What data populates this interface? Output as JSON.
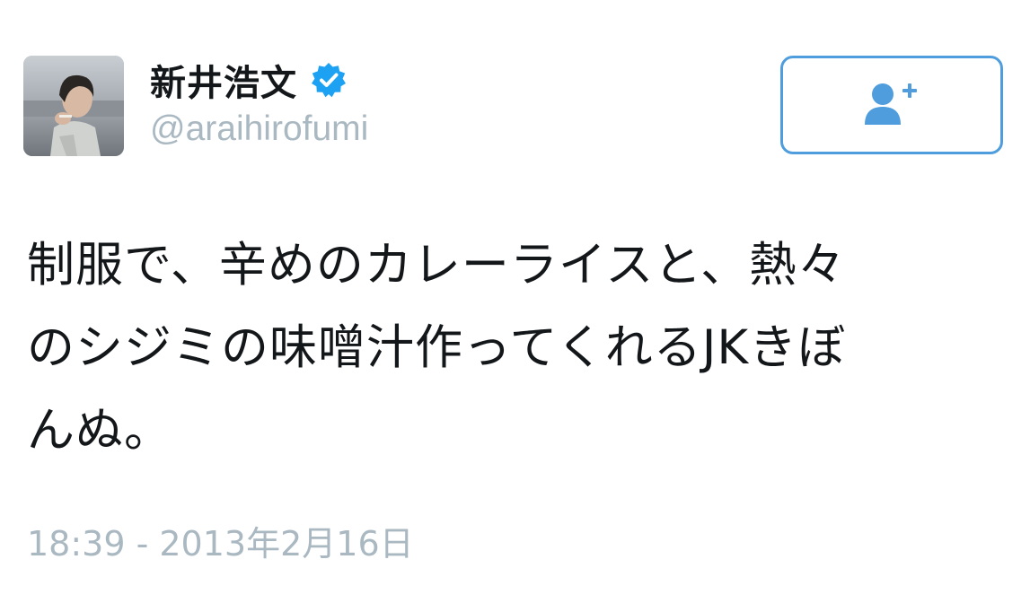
{
  "user": {
    "display_name": "新井浩文",
    "handle": "@araihirofumi",
    "verified": true
  },
  "follow_button": {
    "icon": "add-user-icon"
  },
  "tweet": {
    "text": "制服で、辛めのカレーライスと、熱々\nのシジミの味噌汁作ってくれるJKきぼ\nんぬ。",
    "timestamp": "18:39 - 2013年2月16日"
  },
  "colors": {
    "accent": "#4f9ddd",
    "verified": "#1da1f2",
    "muted_text": "#aab8c2",
    "primary_text": "#14171a"
  }
}
